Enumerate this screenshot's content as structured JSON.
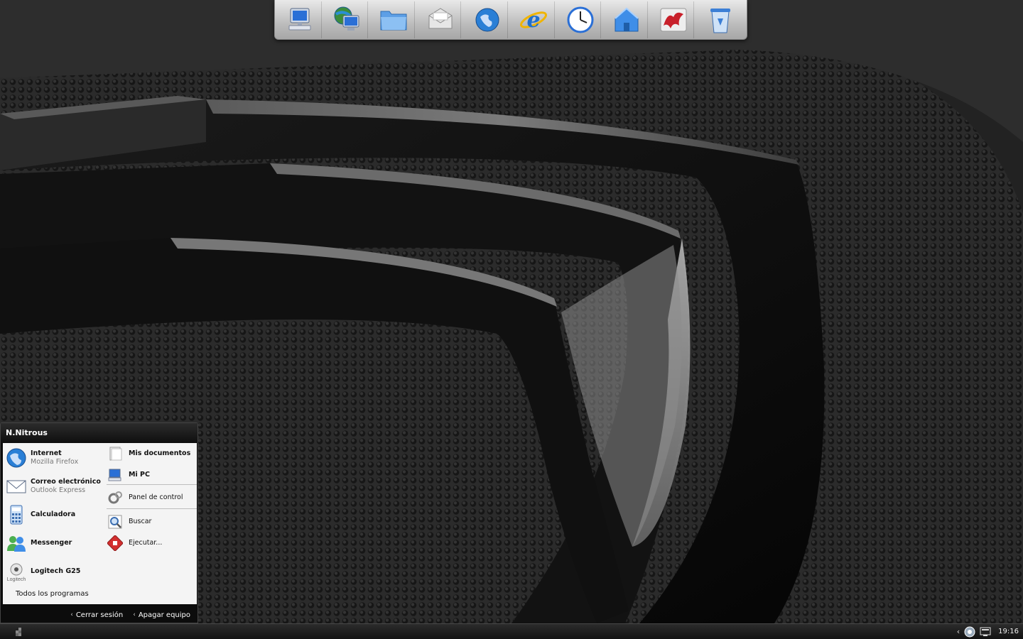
{
  "dock": {
    "items": [
      {
        "icon": "computer-icon"
      },
      {
        "icon": "network-icon"
      },
      {
        "icon": "folder-icon"
      },
      {
        "icon": "mail-icon"
      },
      {
        "icon": "globe-icon"
      },
      {
        "icon": "internet-explorer-icon"
      },
      {
        "icon": "clock-icon"
      },
      {
        "icon": "home-icon"
      },
      {
        "icon": "dragon-icon"
      },
      {
        "icon": "recycle-bin-icon"
      }
    ]
  },
  "start_menu": {
    "user": "N.Nitrous",
    "left_items": [
      {
        "title": "Internet",
        "subtitle": "Mozilla Firefox",
        "icon": "firefox-globe-icon"
      },
      {
        "title": "Correo electrónico",
        "subtitle": "Outlook Express",
        "icon": "envelope-icon"
      },
      {
        "title": "Calculadora",
        "subtitle": "",
        "icon": "calculator-icon"
      },
      {
        "title": "Messenger",
        "subtitle": "",
        "icon": "messenger-icon"
      },
      {
        "title": "Logitech G25",
        "subtitle": "",
        "icon": "logitech-icon"
      }
    ],
    "logo_text": "Logitech",
    "all_programs": "Todos los programas",
    "right_items": [
      {
        "title": "Mis documentos",
        "icon": "documents-icon"
      },
      {
        "title": "Mi PC",
        "icon": "my-computer-icon"
      },
      {
        "title": "Panel de control",
        "icon": "control-panel-icon"
      },
      {
        "title": "Buscar",
        "icon": "search-icon"
      },
      {
        "title": "Ejecutar...",
        "icon": "run-icon"
      }
    ],
    "footer": {
      "logoff": "Cerrar sesión",
      "shutdown": "Apagar equipo"
    }
  },
  "taskbar": {
    "clock": "19:16"
  },
  "colors": {
    "accent": "#2a6fd6",
    "menu_bg": "#f4f4f4",
    "frame": "#0c0c0c"
  }
}
